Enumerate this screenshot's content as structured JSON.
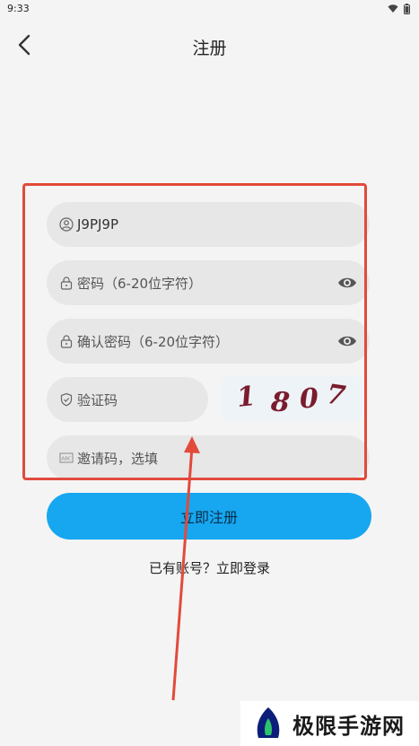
{
  "status": {
    "time": "9:33"
  },
  "nav": {
    "title": "注册"
  },
  "form": {
    "username_value": "J9PJ9P",
    "password_placeholder": "密码（6-20位字符）",
    "confirm_placeholder": "确认密码（6-20位字符）",
    "captcha_placeholder": "验证码",
    "captcha_digits": [
      "1",
      "8",
      "0",
      "7"
    ],
    "invite_placeholder": "邀请码，选填"
  },
  "actions": {
    "register_label": "立即注册",
    "login_prompt": "已有账号？立即登录"
  },
  "watermark": {
    "text": "极限手游网"
  },
  "colors": {
    "primary": "#16a7f0",
    "annotation": "#e24a3b",
    "captcha_text": "#7a1c2e"
  },
  "icons": [
    "back-icon",
    "user-icon",
    "lock-icon",
    "eye-icon",
    "shield-icon",
    "abc-icon",
    "wifi-icon",
    "battery-icon"
  ]
}
